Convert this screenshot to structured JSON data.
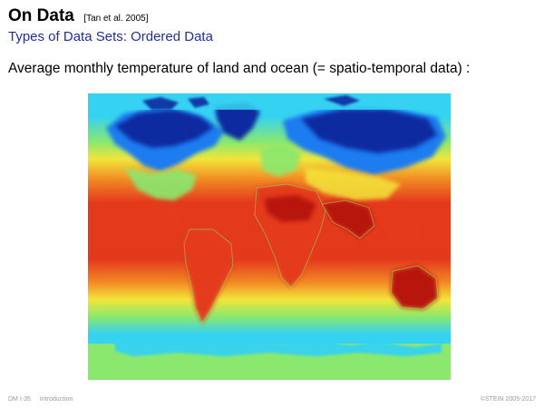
{
  "header": {
    "title": "On Data",
    "citation": "[Tan et al. 2005]",
    "subtitle": "Types of Data Sets: Ordered Data"
  },
  "content": {
    "description": "Average monthly temperature of land and ocean (= spatio-temporal data) :"
  },
  "figure": {
    "colors": {
      "polar_cold": "#0a2ca0",
      "cold": "#1e7cf0",
      "cool": "#36d2f2",
      "mild": "#8ae86e",
      "warm": "#f2e53a",
      "hot": "#f28a24",
      "tropical": "#e43a1c",
      "extreme_hot": "#b81410"
    }
  },
  "footer": {
    "slide_ref": "DM I-35",
    "section": "Introduction",
    "copyright": "©STEIN 2005-2017"
  }
}
